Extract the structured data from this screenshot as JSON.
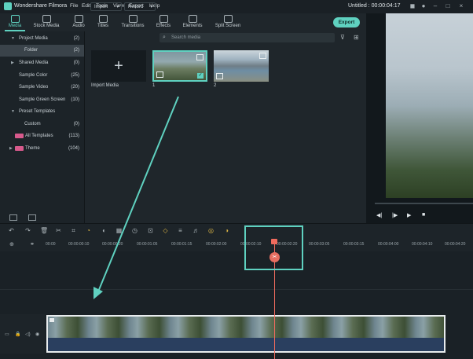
{
  "app": {
    "title": "Wondershare Filmora",
    "project": "Untitled : 00:00:04:17"
  },
  "menu": [
    "File",
    "Edit",
    "Tools",
    "View",
    "Export",
    "Help"
  ],
  "toolbar": {
    "tabs": [
      "Media",
      "Stock Media",
      "Audio",
      "Titles",
      "Transitions",
      "Effects",
      "Elements",
      "Split Screen"
    ],
    "export_label": "Export"
  },
  "library": {
    "items": [
      {
        "label": "Project Media",
        "count": "(2)"
      },
      {
        "label": "Folder",
        "count": "(2)"
      },
      {
        "label": "Shared Media",
        "count": "(0)"
      },
      {
        "label": "Sample Color",
        "count": "(25)"
      },
      {
        "label": "Sample Video",
        "count": "(20)"
      },
      {
        "label": "Sample Green Screen",
        "count": "(10)"
      },
      {
        "label": "Preset Templates",
        "count": ""
      },
      {
        "label": "Custom",
        "count": "(0)"
      },
      {
        "label": "All Templates",
        "count": "(113)"
      },
      {
        "label": "Theme",
        "count": "(104)"
      }
    ]
  },
  "mediabar": {
    "import_label": "Import",
    "record_label": "Record",
    "search_placeholder": "Search media"
  },
  "media": {
    "import_label": "Import Media",
    "clips": [
      "1",
      "2"
    ]
  },
  "ruler": {
    "ticks": [
      "00:00",
      "00:00:00:10",
      "00:00:00:20",
      "00:00:01:05",
      "00:00:01:15",
      "00:00:02:00",
      "00:00:02:10",
      "00:00:02:20",
      "00:00:03:05",
      "00:00:03:15",
      "00:00:04:00",
      "00:00:04:10",
      "00:00:04:20"
    ]
  },
  "colors": {
    "accent": "#5fd1c0",
    "playhead": "#f06b5d",
    "template_badge": "#d75a8c"
  }
}
